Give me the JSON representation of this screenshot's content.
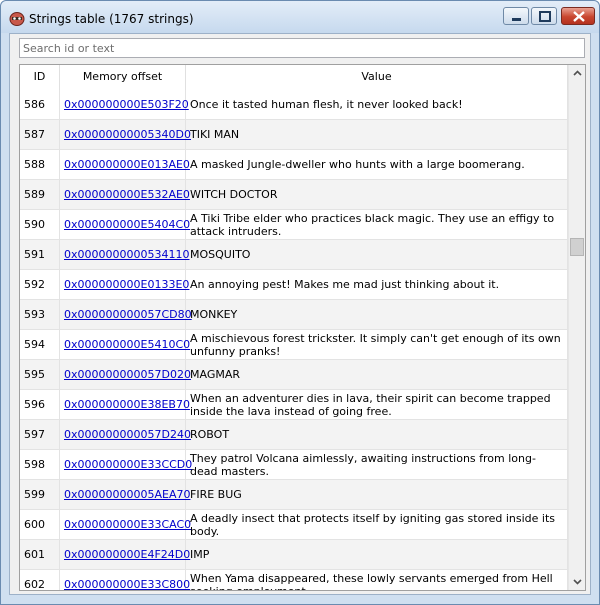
{
  "window": {
    "title": "Strings table (1767 strings)",
    "controls": [
      "minimize",
      "maximize",
      "close"
    ]
  },
  "search": {
    "placeholder": "Search id or text",
    "value": ""
  },
  "table": {
    "columns": [
      "ID",
      "Memory offset",
      "Value"
    ],
    "rows": [
      {
        "id": "586",
        "offset": "0x000000000E503F20",
        "value": "Once it tasted human flesh, it never looked back!"
      },
      {
        "id": "587",
        "offset": "0x00000000005340D0",
        "value": "TIKI MAN"
      },
      {
        "id": "588",
        "offset": "0x000000000E013AE0",
        "value": "A masked Jungle-dweller who hunts with a large boomerang."
      },
      {
        "id": "589",
        "offset": "0x000000000E532AE0",
        "value": "WITCH DOCTOR"
      },
      {
        "id": "590",
        "offset": "0x000000000E5404C0",
        "value": "A Tiki Tribe elder who practices black magic. They use an effigy to attack intruders."
      },
      {
        "id": "591",
        "offset": "0x0000000000534110",
        "value": "MOSQUITO"
      },
      {
        "id": "592",
        "offset": "0x000000000E0133E0",
        "value": "An annoying pest! Makes me mad just thinking about it."
      },
      {
        "id": "593",
        "offset": "0x000000000057CD80",
        "value": "MONKEY"
      },
      {
        "id": "594",
        "offset": "0x000000000E5410C0",
        "value": "A mischievous forest trickster. It simply can't get enough of its own unfunny pranks!"
      },
      {
        "id": "595",
        "offset": "0x000000000057D020",
        "value": "MAGMAR"
      },
      {
        "id": "596",
        "offset": "0x000000000E38EB70",
        "value": "When an adventurer dies in lava, their spirit can become trapped inside the lava instead of going free."
      },
      {
        "id": "597",
        "offset": "0x000000000057D240",
        "value": "ROBOT"
      },
      {
        "id": "598",
        "offset": "0x000000000E33CCD0",
        "value": "They patrol Volcana aimlessly, awaiting instructions from long-dead masters."
      },
      {
        "id": "599",
        "offset": "0x00000000005AEA70",
        "value": "FIRE BUG"
      },
      {
        "id": "600",
        "offset": "0x000000000E33CAC0",
        "value": "A deadly insect that protects itself by igniting gas stored inside its body."
      },
      {
        "id": "601",
        "offset": "0x000000000E4F24D0",
        "value": "IMP"
      },
      {
        "id": "602",
        "offset": "0x000000000E33C800",
        "value": "When Yama disappeared, these lowly servants emerged from Hell seeking employment."
      }
    ]
  },
  "scrollbar": {
    "position": 0.33
  }
}
